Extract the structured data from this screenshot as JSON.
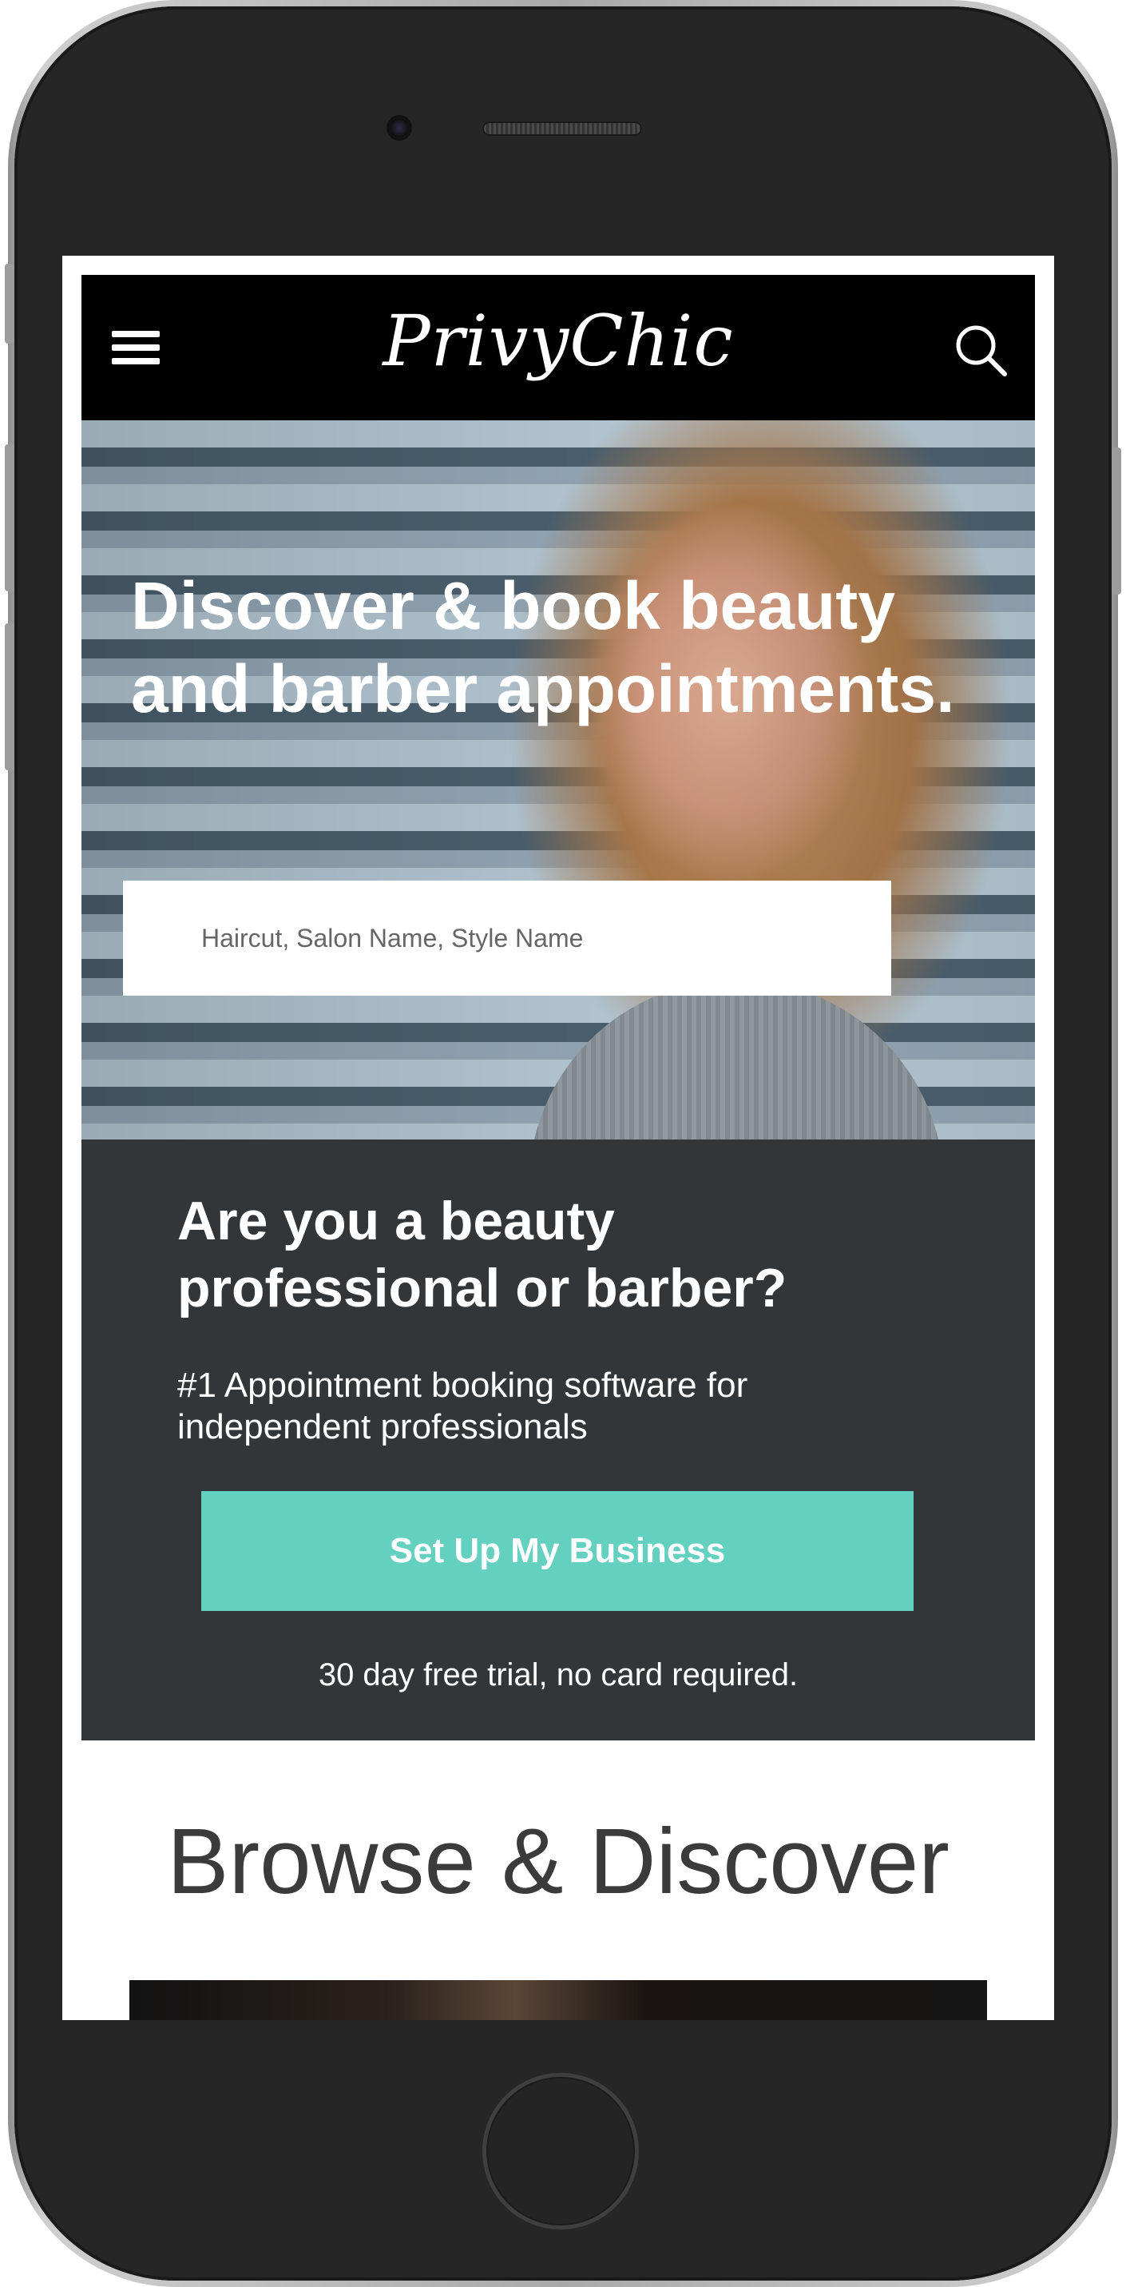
{
  "header": {
    "logo": "PrivyChic",
    "menu_icon": "hamburger-menu-icon",
    "search_icon": "search-icon"
  },
  "hero": {
    "title": "Discover & book beauty and barber appointments.",
    "search_placeholder": "Haircut, Salon Name, Style Name"
  },
  "pro": {
    "heading": "Are you a beauty professional or barber?",
    "subheading": "#1 Appointment booking software for independent professionals",
    "cta_label": "Set Up My Business",
    "trial_note": "30 day free trial, no card required."
  },
  "browse": {
    "title": "Browse & Discover"
  },
  "colors": {
    "header_bg": "#000000",
    "pro_bg": "#333638",
    "accent": "#63d0c0",
    "text_light": "#ffffff"
  }
}
